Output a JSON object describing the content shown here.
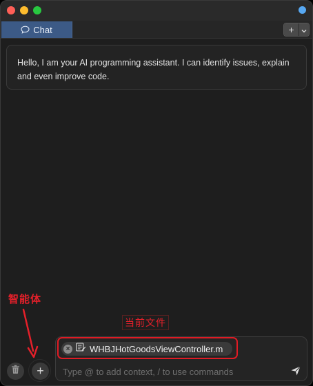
{
  "colors": {
    "status_dot": "#57a8f2",
    "tab_active": "#3c5a86",
    "annotation": "#e5202a"
  },
  "tabs": [
    {
      "label": "Chat",
      "icon": "chat-bubble-icon",
      "active": true
    }
  ],
  "tab_actions": {
    "add_label": "+",
    "dropdown_icon": "chevron-down-icon"
  },
  "messages": [
    {
      "role": "assistant",
      "text": "Hello, I am your AI programming assistant. I can identify issues, explain and even improve code."
    }
  ],
  "annotations": {
    "agent_label": "智能体",
    "current_file_label": "当前文件"
  },
  "context_file": {
    "name": "WHBJHotGoodsViewController.m",
    "icon": "file-icon",
    "remove_icon": "close-icon"
  },
  "input": {
    "value": "",
    "placeholder": "Type @ to add context, / to use commands"
  },
  "bottom_buttons": {
    "trash_icon": "trash-icon",
    "add_label": "+"
  },
  "send_icon": "send-icon"
}
